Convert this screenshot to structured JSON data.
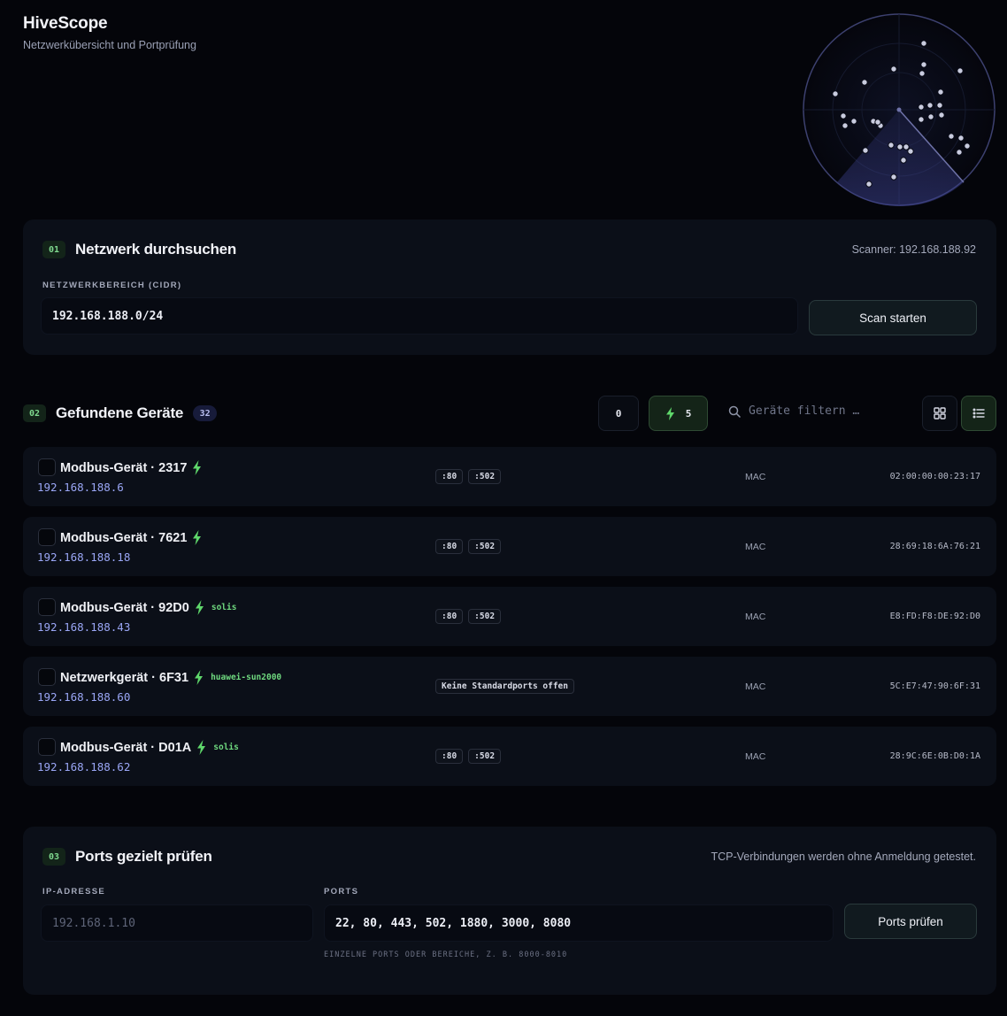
{
  "app": {
    "title": "HiveScope",
    "subtitle": "Netzwerkübersicht und Portprüfung"
  },
  "scan": {
    "step": "01",
    "title": "Netzwerk durchsuchen",
    "scanner": "Scanner: 192.168.188.92",
    "cidr_label": "NETZWERKBEREICH (CIDR)",
    "cidr_value": "192.168.188.0/24",
    "button": "Scan starten"
  },
  "devices_section": {
    "step": "02",
    "title": "Gefundene Geräte",
    "count": "32",
    "filter_zero": "0",
    "filter_bolt_count": "5",
    "search_placeholder": "Geräte filtern …"
  },
  "devices": [
    {
      "name": "Modbus-Gerät · 2317",
      "tag": "",
      "ip": "192.168.188.6",
      "ports": [
        ":80",
        ":502"
      ],
      "mac_label": "MAC",
      "mac": "02:00:00:00:23:17"
    },
    {
      "name": "Modbus-Gerät · 7621",
      "tag": "",
      "ip": "192.168.188.18",
      "ports": [
        ":80",
        ":502"
      ],
      "mac_label": "MAC",
      "mac": "28:69:18:6A:76:21"
    },
    {
      "name": "Modbus-Gerät · 92D0",
      "tag": "solis",
      "ip": "192.168.188.43",
      "ports": [
        ":80",
        ":502"
      ],
      "mac_label": "MAC",
      "mac": "E8:FD:F8:DE:92:D0"
    },
    {
      "name": "Netzwerkgerät · 6F31",
      "tag": "huawei-sun2000",
      "ip": "192.168.188.60",
      "ports": [
        "Keine Standardports offen"
      ],
      "mac_label": "MAC",
      "mac": "5C:E7:47:90:6F:31"
    },
    {
      "name": "Modbus-Gerät · D01A",
      "tag": "solis",
      "ip": "192.168.188.62",
      "ports": [
        ":80",
        ":502"
      ],
      "mac_label": "MAC",
      "mac": "28:9C:6E:0B:D0:1A"
    }
  ],
  "ports_check": {
    "step": "03",
    "title": "Ports gezielt prüfen",
    "note": "TCP-Verbindungen werden ohne Anmeldung getestet.",
    "ip_label": "IP-ADRESSE",
    "ip_placeholder": "192.168.1.10",
    "ports_label": "PORTS",
    "ports_value": "22, 80, 443, 502, 1880, 3000, 8080",
    "helper": "EINZELNE PORTS ODER BEREICHE, Z. B. 8000-8010",
    "button": "Ports prüfen"
  },
  "colors": {
    "accent_green": "#7fd98f",
    "ip_blue": "#9aa6f5",
    "bolt": "#5fd86b"
  }
}
